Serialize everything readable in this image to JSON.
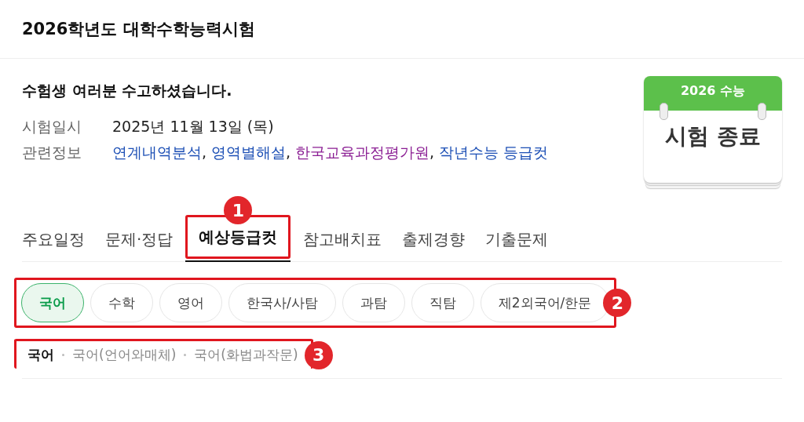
{
  "header": {
    "title": "2026학년도 대학수학능력시험"
  },
  "info": {
    "heading": "수험생 여러분 수고하셨습니다.",
    "rows": [
      {
        "kind": "text",
        "label": "시험일시",
        "value": "2025년 11월 13일 (목)"
      },
      {
        "kind": "links",
        "label": "관련정보",
        "separator": ",",
        "links": [
          {
            "text": "연계내역분석",
            "color": "#1c4fb5"
          },
          {
            "text": "영역별해설",
            "color": "#1c4fb5"
          },
          {
            "text": "한국교육과정평가원",
            "color": "#8a1d93"
          },
          {
            "text": "작년수능 등급컷",
            "color": "#1c4fb5"
          }
        ]
      }
    ]
  },
  "badge": {
    "top": "2026 수능",
    "main": "시험 종료"
  },
  "tabs": [
    {
      "label": "주요일정",
      "selected": false
    },
    {
      "label": "문제·정답",
      "selected": false
    },
    {
      "label": "예상등급컷",
      "selected": true
    },
    {
      "label": "참고배치표",
      "selected": false
    },
    {
      "label": "출제경향",
      "selected": false
    },
    {
      "label": "기출문제",
      "selected": false
    }
  ],
  "chips": [
    {
      "label": "국어",
      "selected": true
    },
    {
      "label": "수학",
      "selected": false
    },
    {
      "label": "영어",
      "selected": false
    },
    {
      "label": "한국사/사탐",
      "selected": false
    },
    {
      "label": "과탐",
      "selected": false
    },
    {
      "label": "직탐",
      "selected": false
    },
    {
      "label": "제2외국어/한문",
      "selected": false
    }
  ],
  "subtabs": [
    {
      "label": "국어",
      "selected": true
    },
    {
      "label": "국어(언어와매체)",
      "selected": false
    },
    {
      "label": "국어(화법과작문)",
      "selected": false
    }
  ],
  "annotations": [
    {
      "number": "1"
    },
    {
      "number": "2"
    },
    {
      "number": "3"
    }
  ]
}
